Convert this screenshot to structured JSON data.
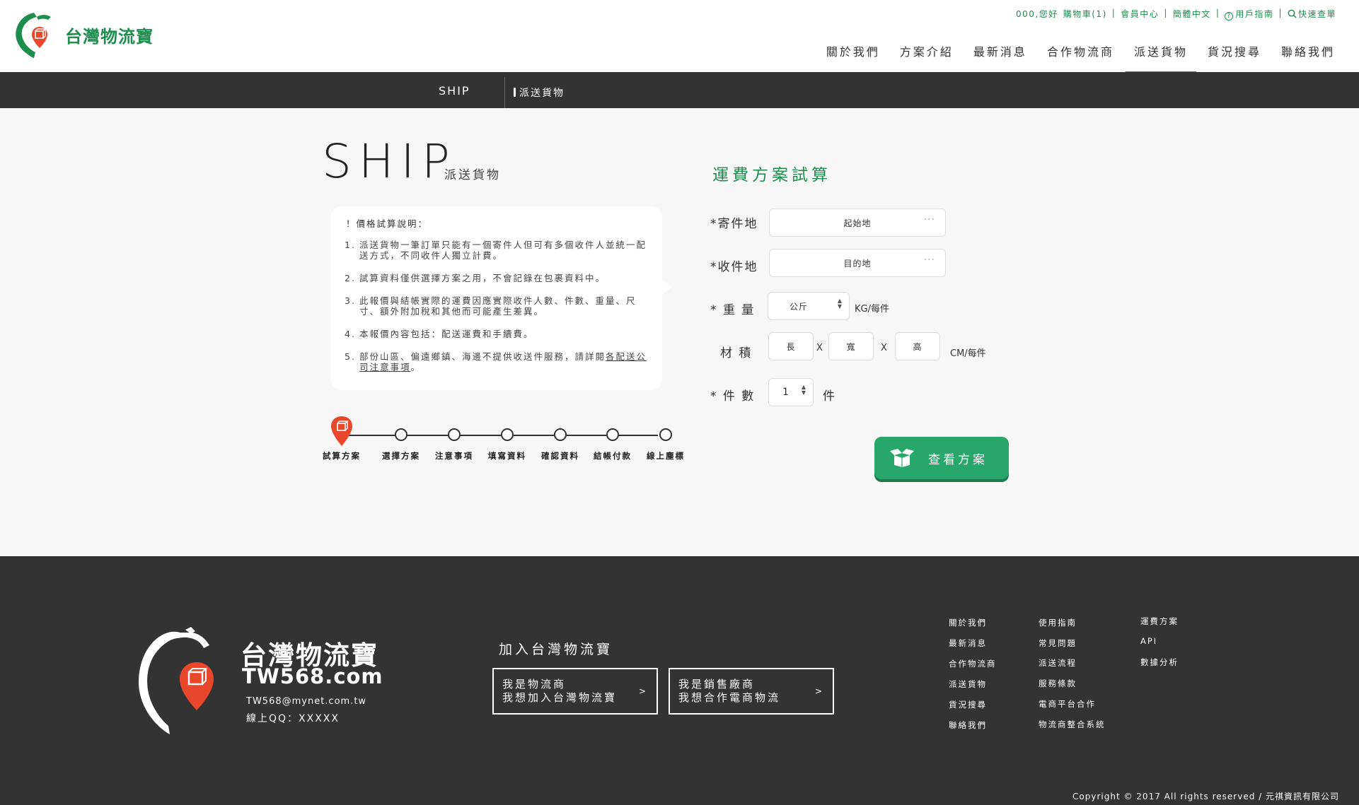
{
  "header": {
    "logo_text": "台灣物流寶",
    "util": {
      "greeting": "000,您好",
      "cart": "購物車(1)",
      "member": "會員中心",
      "lang": "簡體中文",
      "guide": "用戶指南",
      "quick_search": "快速查單"
    },
    "nav": [
      "關於我們",
      "方案介紹",
      "最新消息",
      "合作物流商",
      "派送貨物",
      "貨況搜尋",
      "聯絡我們"
    ],
    "active_nav": "派送貨物"
  },
  "breadcrumb": {
    "en": "SHIP",
    "zh": "派送貨物"
  },
  "page": {
    "title_en": "SHIP",
    "title_zh": "派送貨物",
    "info_title": "！價格試算說明：",
    "info_items": [
      {
        "num": "1.",
        "text": "派送貨物一筆訂單只能有一個寄件人但可有多個收件人並統一配送方式，不同收件人獨立計費。"
      },
      {
        "num": "2.",
        "text": "試算資料僅供選擇方案之用，不會記錄在包裹資料中。"
      },
      {
        "num": "3.",
        "text": "此報價與結帳實際的運費因應實際收件人數、件數、重量、尺寸、額外附加稅和其他而可能產生差異。"
      },
      {
        "num": "4.",
        "text": "本報價內容包括：配送運費和手續費。"
      },
      {
        "num": "5.",
        "text_before": "部份山區、偏遠鄉鎮、海邊不提供收送件服務，請詳閱",
        "link": "各配送公司注意事項",
        "text_after": "。"
      }
    ],
    "steps": [
      "試算方案",
      "選擇方案",
      "注意事項",
      "填寫資料",
      "確認資料",
      "結帳付款",
      "線上塵標"
    ]
  },
  "form": {
    "title": "運費方案試算",
    "sender_label": "*寄件地",
    "sender_value": "起始地",
    "receiver_label": "*收件地",
    "receiver_value": "目的地",
    "weight_label": "* 重 量",
    "weight_unit_value": "公斤",
    "weight_suffix": "KG/每件",
    "volume_label": "材 積",
    "length_placeholder": "長",
    "width_placeholder": "寬",
    "height_placeholder": "高",
    "x_sep": "X",
    "volume_suffix": "CM/每件",
    "count_label": "* 件 數",
    "count_value": "1",
    "count_suffix": "件",
    "submit": "查看方案"
  },
  "footer": {
    "brand": "台灣物流寶",
    "domain": "TW568.com",
    "email": "TW568@mynet.com.tw",
    "qq": "線上QQ：XXXXX",
    "join_title": "加入台灣物流寶",
    "cta_left": [
      "我是物流商",
      "我想加入台灣物流寶"
    ],
    "cta_right": [
      "我是銷售廠商",
      "我想合作電商物流"
    ],
    "cta_arrow": ">",
    "col1": [
      "關於我們",
      "最新消息",
      "合作物流商",
      "派送貨物",
      "貨況搜尋",
      "聯絡我們"
    ],
    "col2": [
      "使用指南",
      "常見問題",
      "派送流程",
      "服務條款",
      "電商平台合作",
      "物流商整合系統"
    ],
    "col3": [
      "運費方案",
      "API",
      "數據分析"
    ],
    "copyright": "Copyright © 2017 All rights reserved / 元祺資訊有限公司"
  },
  "colors": {
    "brand_green": "#1e8e4e",
    "button_green": "#27a86a",
    "pin_red": "#e8472c",
    "dark_bar": "#333333"
  }
}
